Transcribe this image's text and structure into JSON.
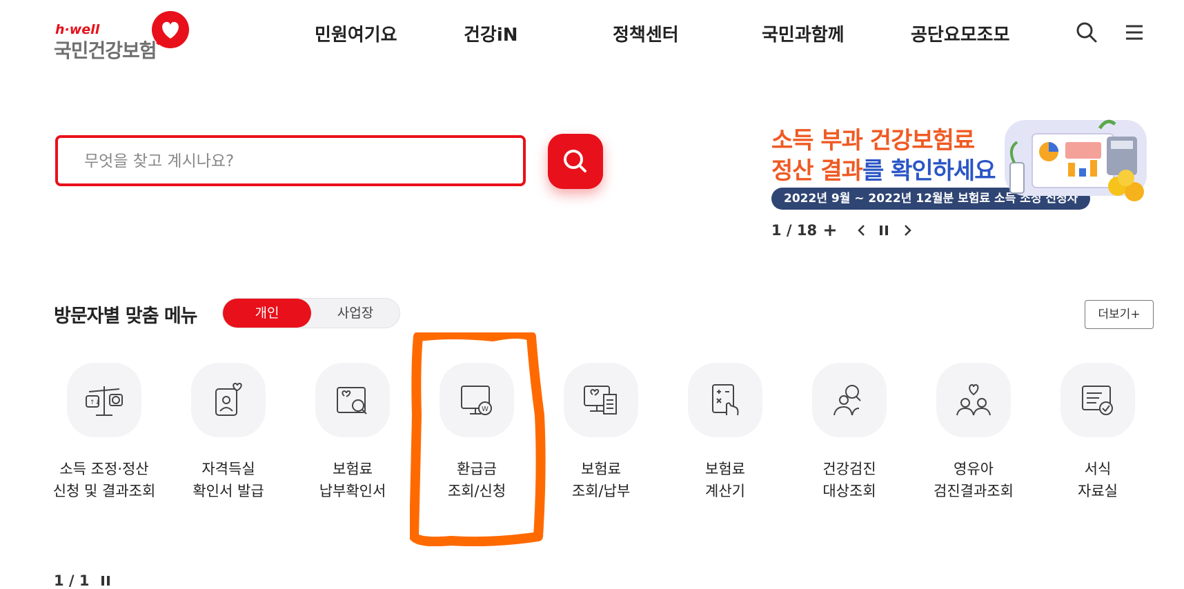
{
  "logo": {
    "hwell": "h·well",
    "name": "국민건강보험"
  },
  "nav": [
    "민원여기요",
    "건강iN",
    "정책센터",
    "국민과함께",
    "공단요모조모"
  ],
  "search": {
    "placeholder": "무엇을 찾고 계시나요?"
  },
  "banner": {
    "line1": "소득 부과 건강보험료",
    "line2_red": "정산 결과",
    "line2_blue": "를 확인하세요",
    "sub": "2022년 9월 ~ 2022년 12월분 보험료 소득 조정 신청자",
    "pager": "1 / 18"
  },
  "section": {
    "title": "방문자별 맞춤 메뉴",
    "toggle_on": "개인",
    "toggle_off": "사업장",
    "more": "더보기+"
  },
  "menu": [
    {
      "line1": "소득 조정·정산",
      "line2": "신청 및 결과조회",
      "icon": "scale-icon"
    },
    {
      "line1": "자격득실",
      "line2": "확인서 발급",
      "icon": "id-card-heart-icon"
    },
    {
      "line1": "보험료",
      "line2": "납부확인서",
      "icon": "card-search-icon"
    },
    {
      "line1": "환급금",
      "line2": "조회/신청",
      "icon": "monitor-won-icon"
    },
    {
      "line1": "보험료",
      "line2": "조회/납부",
      "icon": "monitor-receipt-icon"
    },
    {
      "line1": "보험료",
      "line2": "계산기",
      "icon": "calculator-hand-icon"
    },
    {
      "line1": "건강검진",
      "line2": "대상조회",
      "icon": "person-search-icon"
    },
    {
      "line1": "영유아",
      "line2": "검진결과조회",
      "icon": "family-heart-icon"
    },
    {
      "line1": "서식",
      "line2": "자료실",
      "icon": "document-check-icon"
    }
  ],
  "bottom_pager": "1 / 1",
  "colors": {
    "brand_red": "#e8101a",
    "highlight_orange": "#ff6a00",
    "banner_navy": "#2f4574"
  }
}
